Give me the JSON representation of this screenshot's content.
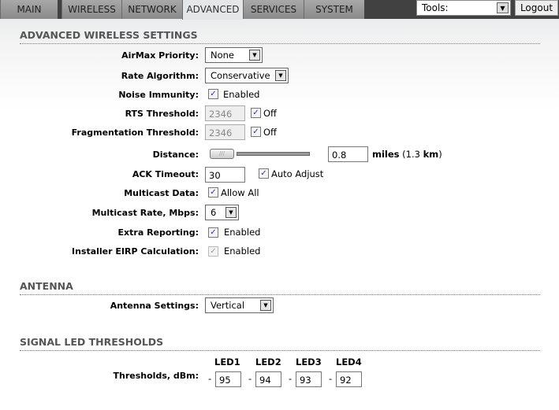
{
  "tabs": [
    "MAIN",
    "WIRELESS",
    "NETWORK",
    "ADVANCED",
    "SERVICES",
    "SYSTEM"
  ],
  "active_tab": "ADVANCED",
  "tools": {
    "value": "Tools:"
  },
  "logout": "Logout",
  "advanced": {
    "title": "ADVANCED WIRELESS SETTINGS",
    "airmax_label": "AirMax Priority:",
    "airmax_value": "None",
    "rate_label": "Rate Algorithm:",
    "rate_value": "Conservative",
    "noise_label": "Noise Immunity:",
    "noise_cb": "Enabled",
    "rts_label": "RTS Threshold:",
    "rts_value": "2346",
    "rts_cb": "Off",
    "frag_label": "Fragmentation Threshold:",
    "frag_value": "2346",
    "frag_cb": "Off",
    "distance_label": "Distance:",
    "distance_value": "0.8",
    "distance_unit": "miles",
    "distance_km_open": "(1.3 ",
    "distance_km_unit": "km",
    "distance_km_close": ")",
    "ack_label": "ACK Timeout:",
    "ack_value": "30",
    "ack_cb": "Auto Adjust",
    "mcast_label": "Multicast Data:",
    "mcast_cb": "Allow All",
    "mrate_label": "Multicast Rate, Mbps:",
    "mrate_value": "6",
    "extra_label": "Extra Reporting:",
    "extra_cb": "Enabled",
    "eirp_label": "Installer EIRP Calculation:",
    "eirp_cb": "Enabled"
  },
  "antenna": {
    "title": "ANTENNA",
    "label": "Antenna Settings:",
    "value": "Vertical"
  },
  "led": {
    "title": "SIGNAL LED THRESHOLDS",
    "label": "Thresholds, dBm:",
    "sign": "-",
    "headers": [
      "LED1",
      "LED2",
      "LED3",
      "LED4"
    ],
    "values": [
      "95",
      "94",
      "93",
      "92"
    ]
  }
}
